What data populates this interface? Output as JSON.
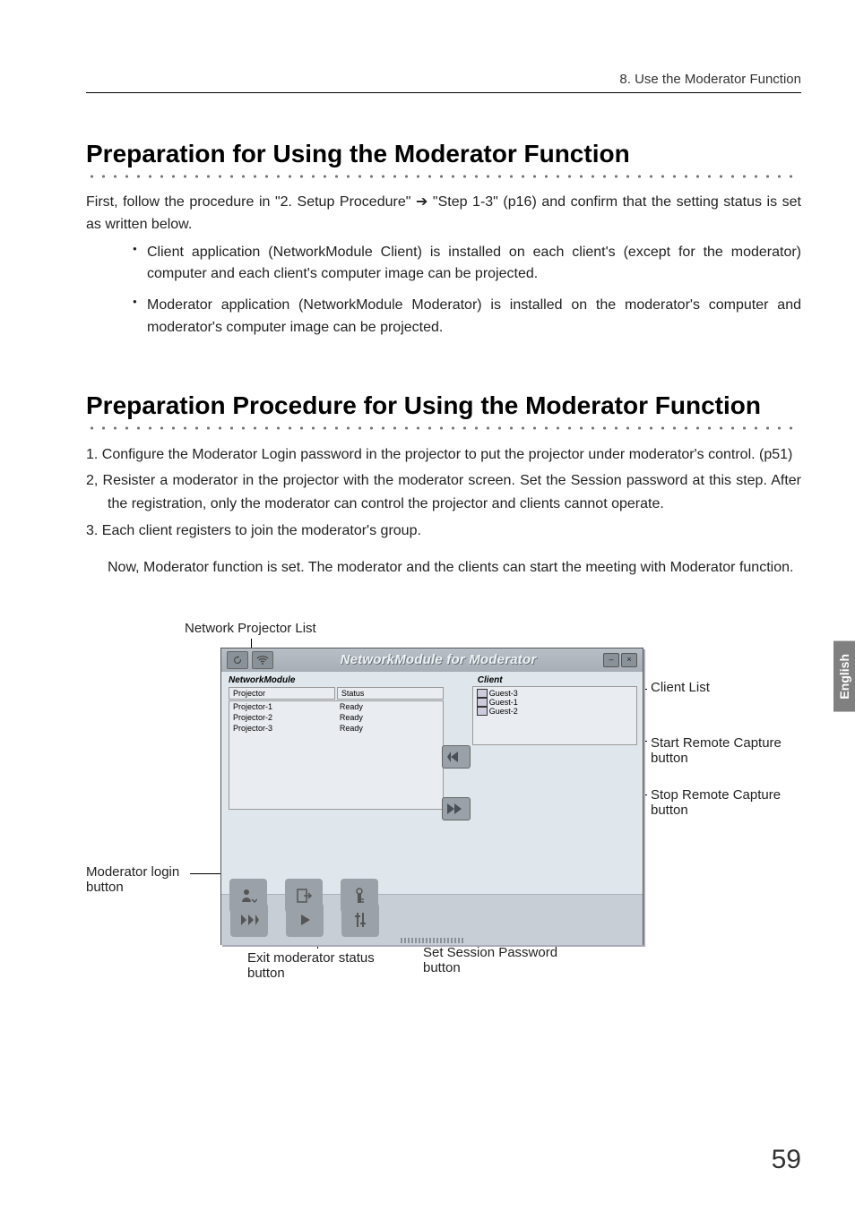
{
  "header": {
    "chapter": "8. Use the Moderator Function"
  },
  "section1": {
    "title": "Preparation for Using the Moderator Function",
    "intro": "First, follow the procedure in \"2. Setup Procedure\" ➔ \"Step 1-3\" (p16) and confirm that the setting status is set as written below.",
    "bullets": [
      "Client application (NetworkModule Client) is installed on each client's (except for the moderator) computer and each client's computer image can be projected.",
      "Moderator application (NetworkModule Moderator) is installed on the moderator's computer and moderator's computer image can be projected."
    ]
  },
  "section2": {
    "title": "Preparation Procedure for Using the Moderator Function",
    "items": [
      "1. Configure the Moderator Login password in the projector to put the projector under moderator's control.  (p51)",
      "2, Resister a moderator in the projector with the moderator screen.  Set the Session password at this step.  After the registration, only the moderator can control the projector and clients cannot operate.",
      "3. Each client registers to join the moderator's group."
    ],
    "closing": "Now, Moderator function is set.  The moderator and the clients can start the meeting with Moderator function."
  },
  "figure": {
    "label_top": "Network Projector List",
    "callouts": {
      "client_list": "Client List",
      "start_remote": "Start Remote Capture button",
      "stop_remote": "Stop Remote Capture button",
      "moderator_login": "Moderator login button",
      "exit_moderator": "Exit moderator status button",
      "set_session": "Set Session Password button"
    },
    "app": {
      "title": "NetworkModule for Moderator",
      "left_group": "NetworkModule",
      "col_projector": "Projector",
      "col_status": "Status",
      "projectors": [
        {
          "name": "Projector-1",
          "status": "Ready"
        },
        {
          "name": "Projector-2",
          "status": "Ready"
        },
        {
          "name": "Projector-3",
          "status": "Ready"
        }
      ],
      "right_group": "Client",
      "clients": [
        "Guest-3",
        "Guest-1",
        "Guest-2"
      ]
    }
  },
  "side_tab": "English",
  "page_number": "59"
}
